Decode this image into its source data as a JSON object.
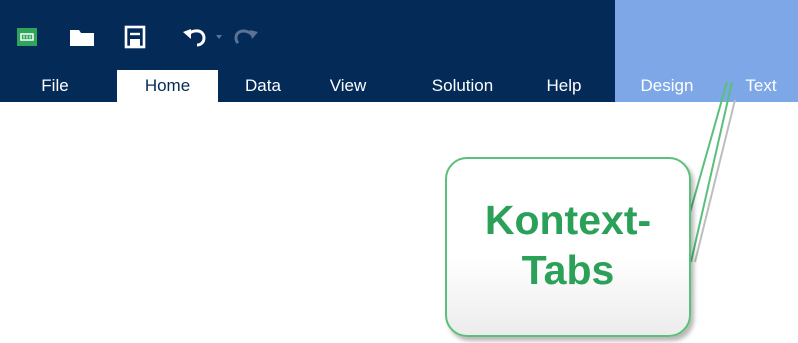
{
  "quick_access": {
    "app_icon": "app-logo-icon",
    "open": "folder-icon",
    "save": "save-icon",
    "undo": "undo-icon",
    "undo_dropdown": "chevron-down-icon",
    "redo": "redo-icon"
  },
  "tabs": [
    {
      "label": "File"
    },
    {
      "label": "Home",
      "active": true
    },
    {
      "label": "Data"
    },
    {
      "label": "View"
    },
    {
      "label": "Solution"
    },
    {
      "label": "Help"
    },
    {
      "label": "Design",
      "contextual": true
    },
    {
      "label": "Text",
      "contextual": true
    }
  ],
  "callout": {
    "line1": "Kontext-",
    "line2": "Tabs"
  },
  "colors": {
    "ribbon": "#042a58",
    "context_zone": "#7da7e6",
    "callout_border": "#5bbf7c",
    "callout_text": "#2aa058",
    "app_icon": "#2ea55a"
  }
}
